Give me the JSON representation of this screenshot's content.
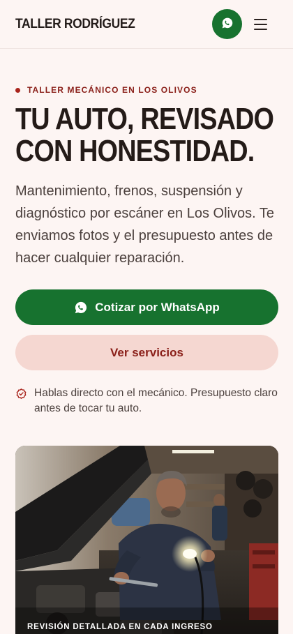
{
  "header": {
    "brand": "TALLER RODRÍGUEZ",
    "whatsapp_icon": "whatsapp-icon",
    "menu_icon": "hamburger-menu-icon"
  },
  "hero": {
    "eyebrow": "TALLER MECÁNICO EN LOS OLIVOS",
    "headline_lines": [
      "TU AUTO, REVISADO",
      "CON HONESTIDAD."
    ],
    "lead": "Mantenimiento, frenos, suspensión y diagnóstico por escáner en Los Olivos. Te enviamos fotos y el presupuesto antes de hacer cualquier reparación.",
    "primary_cta": "Cotizar por WhatsApp",
    "secondary_cta": "Ver servicios",
    "trust_icon": "badge-check-icon",
    "trust_text": "Hablas directo con el mecánico. Presupuesto claro antes de tocar tu auto."
  },
  "photo": {
    "caption": "REVISIÓN DETALLADA EN CADA INGRESO",
    "subject": "mechanic inspecting engine bay with work lamp"
  },
  "colors": {
    "background": "#fdf5f3",
    "primary_green": "#17722f",
    "accent_red": "#8a1f19",
    "secondary_button_bg": "#f5d7d1",
    "text_dark": "#241b18"
  }
}
